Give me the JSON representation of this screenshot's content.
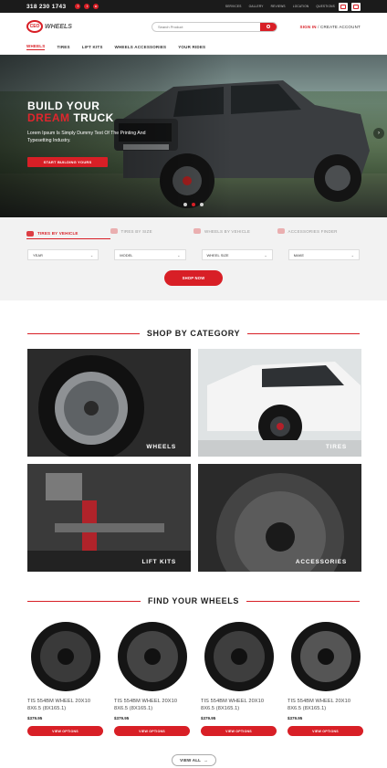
{
  "topbar": {
    "phone": "318 230 1743",
    "links": [
      "SERVICES",
      "GALLERY",
      "REVIEWS",
      "LOCATION",
      "QUESTIONS"
    ]
  },
  "header": {
    "logo_text": "CEO",
    "logo_wordmark": "WHEELS",
    "search_placeholder": "Search Product",
    "sign_in": "SIGN IN",
    "separator": " / ",
    "create_account": "CREATE ACCOUNT"
  },
  "nav": {
    "items": [
      "WHEELS",
      "TIRES",
      "LIFT KITS",
      "WHEELS ACCESSORIES",
      "YOUR RIDES"
    ]
  },
  "hero": {
    "line1": "BUILD YOUR",
    "line2_red": "DREAM",
    "line2_rest": " TRUCK",
    "subtitle": "Lorem Ipsum Is Simply Dummy Text Of The Printing And Typesetting Industry.",
    "cta": "START BUILDING YOURS",
    "active_slide": 2,
    "slide_count": 3
  },
  "finder": {
    "tabs": [
      "TIRES BY VEHICLE",
      "TIRES BY SIZE",
      "WHEELS BY VEHICLE",
      "ACCESSORIES FINDER"
    ],
    "selects": [
      "YEAR",
      "MODEL",
      "WHEEL SIZE",
      "MAKE"
    ],
    "button": "SHOP NOW"
  },
  "categories": {
    "title": "SHOP BY CATEGORY",
    "items": [
      "WHEELS",
      "TIRES",
      "LIFT KITS",
      "ACCESSORIES"
    ]
  },
  "wheels": {
    "title": "FIND YOUR WHEELS",
    "products": [
      {
        "name": "TIS 554BM WHEEL 20X10 8X6.5 (8X165.1)",
        "price": "$379.95",
        "button": "VIEW OPTIONS"
      },
      {
        "name": "TIS 554BM WHEEL 20X10 8X6.5 (8X165.1)",
        "price": "$379.95",
        "button": "VIEW OPTIONS"
      },
      {
        "name": "TIS 554BM WHEEL 20X10 8X6.5 (8X165.1)",
        "price": "$379.95",
        "button": "VIEW OPTIONS"
      },
      {
        "name": "TIS 554BM WHEEL 20X10 8X6.5 (8X165.1)",
        "price": "$379.95",
        "button": "VIEW OPTIONS"
      }
    ],
    "view_all": "VIEW ALL"
  },
  "colors": {
    "brand_red": "#d81f26",
    "dark": "#1b1b1b"
  }
}
